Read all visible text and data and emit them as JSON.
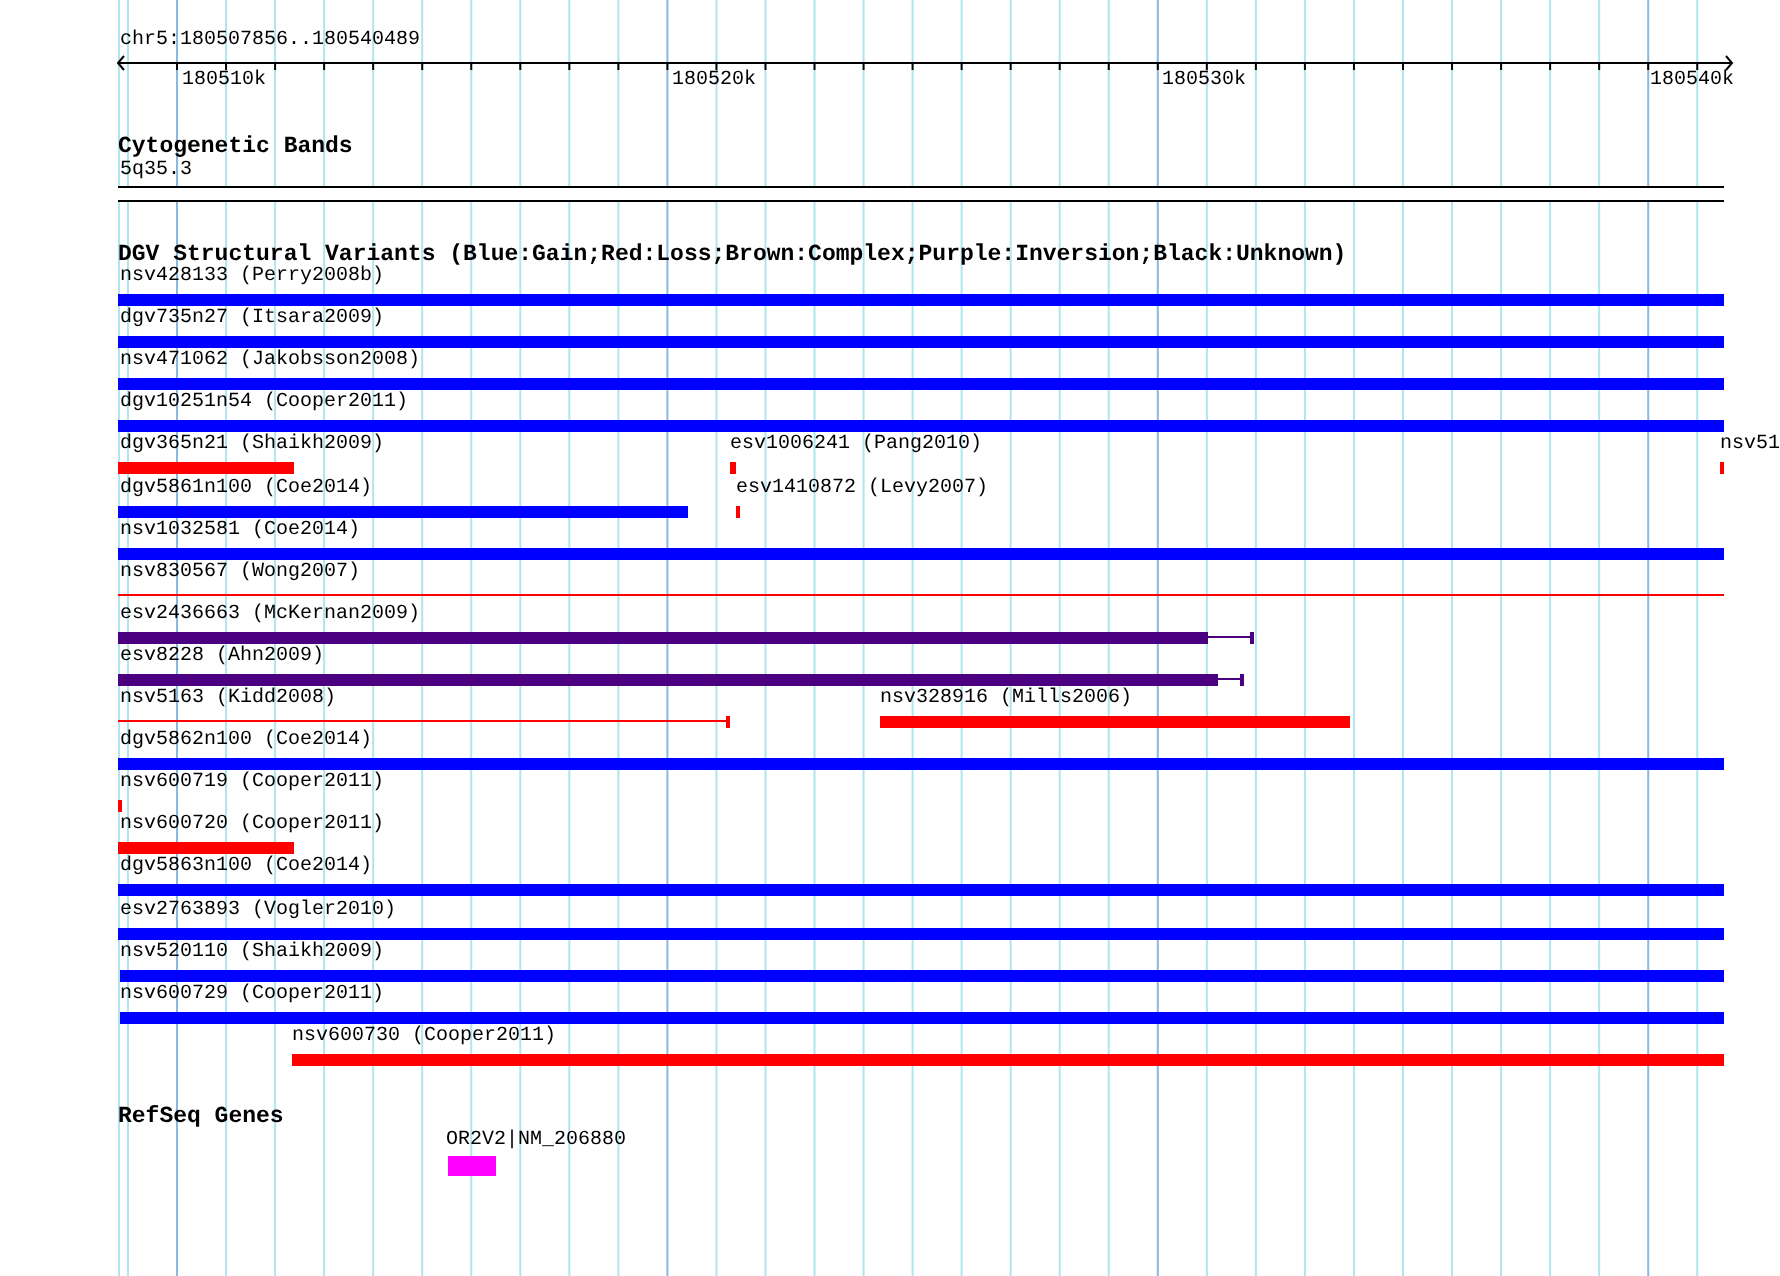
{
  "ruler": {
    "range": "chr5:180507856..180540489",
    "ticks": [
      "180510k",
      "180520k",
      "180530k",
      "180540k"
    ]
  },
  "cytogenetic_bands": {
    "title": "Cytogenetic Bands",
    "band": "5q35.3"
  },
  "structural_variants": {
    "title": "DGV Structural Variants (Blue:Gain;Red:Loss;Brown:Complex;Purple:Inversion;Black:Unknown)",
    "features": [
      {
        "label": "nsv428133 (Perry2008b)",
        "color": "#0000ff"
      },
      {
        "label": "dgv735n27 (Itsara2009)",
        "color": "#0000ff"
      },
      {
        "label": "nsv471062 (Jakobsson2008)",
        "color": "#0000ff"
      },
      {
        "label": "dgv10251n54 (Cooper2011)",
        "color": "#0000ff"
      },
      {
        "label": "dgv365n21 (Shaikh2009)",
        "color": "#ff0000"
      },
      {
        "label": "esv1006241 (Pang2010)",
        "color": "#ff0000"
      },
      {
        "label": "nsv51",
        "color": "#ff0000"
      },
      {
        "label": "dgv5861n100 (Coe2014)",
        "color": "#0000ff"
      },
      {
        "label": "esv1410872 (Levy2007)",
        "color": "#ff0000"
      },
      {
        "label": "nsv1032581 (Coe2014)",
        "color": "#0000ff"
      },
      {
        "label": "nsv830567 (Wong2007)",
        "color": "#ff0000"
      },
      {
        "label": "esv2436663 (McKernan2009)",
        "color": "#4b0082"
      },
      {
        "label": "esv8228 (Ahn2009)",
        "color": "#4b0082"
      },
      {
        "label": "nsv5163 (Kidd2008)",
        "color": "#ff0000"
      },
      {
        "label": "nsv328916 (Mills2006)",
        "color": "#ff0000"
      },
      {
        "label": "dgv5862n100 (Coe2014)",
        "color": "#0000ff"
      },
      {
        "label": "nsv600719 (Cooper2011)",
        "color": "#ff0000"
      },
      {
        "label": "nsv600720 (Cooper2011)",
        "color": "#ff0000"
      },
      {
        "label": "dgv5863n100 (Coe2014)",
        "color": "#0000ff"
      },
      {
        "label": "esv2763893 (Vogler2010)",
        "color": "#0000ff"
      },
      {
        "label": "nsv520110 (Shaikh2009)",
        "color": "#0000ff"
      },
      {
        "label": "nsv600729 (Cooper2011)",
        "color": "#0000ff"
      },
      {
        "label": "nsv600730 (Cooper2011)",
        "color": "#ff0000"
      }
    ]
  },
  "refseq_genes": {
    "title": "RefSeq Genes",
    "genes": [
      {
        "label": "OR2V2|NM_206880"
      }
    ]
  }
}
